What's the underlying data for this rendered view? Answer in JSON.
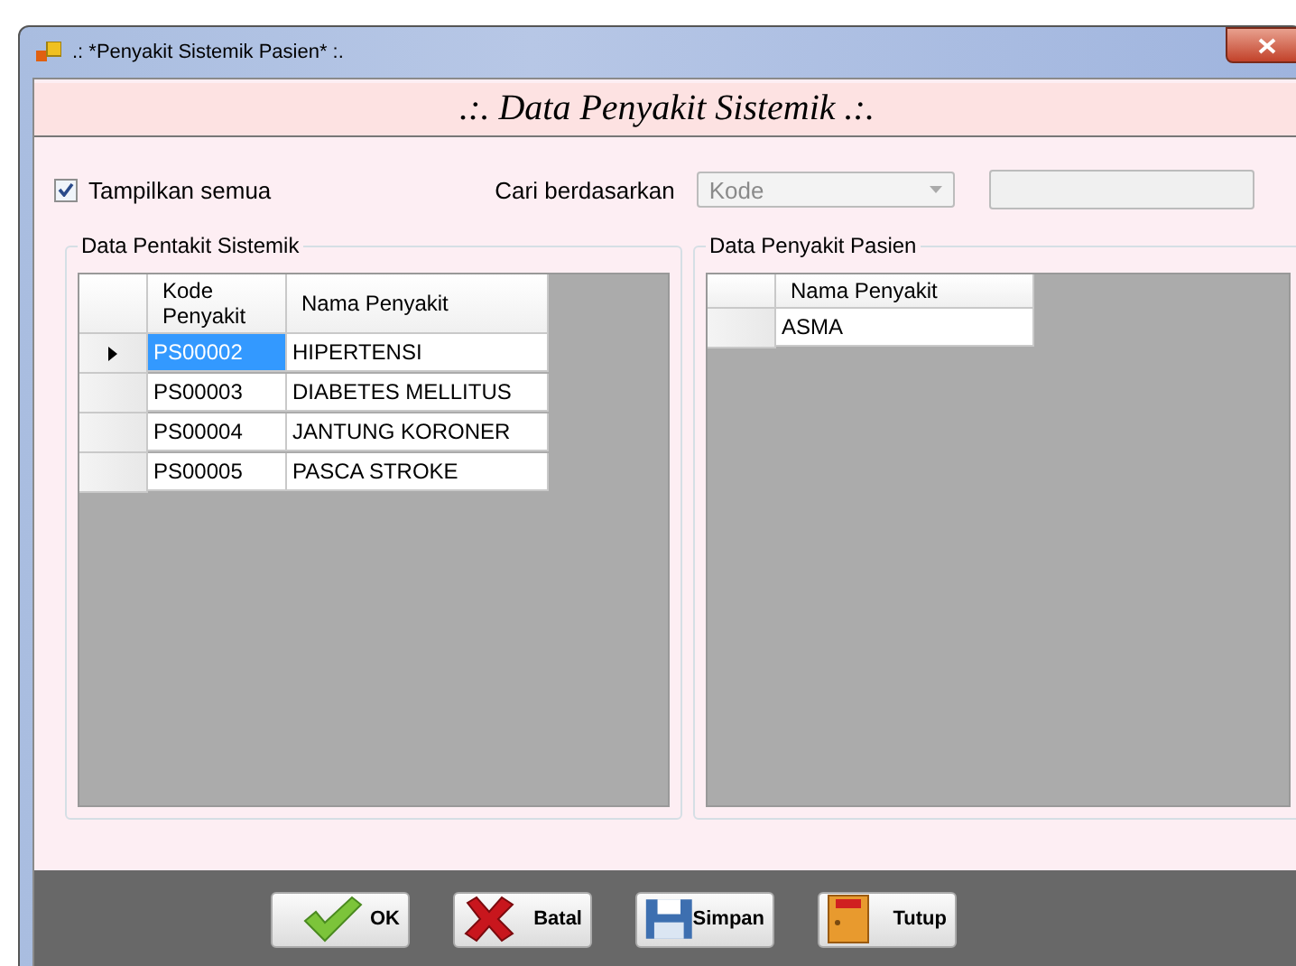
{
  "window": {
    "title": ".: *Penyakit Sistemik Pasien* :."
  },
  "header": ".:. Data Penyakit Sistemik .:.",
  "filter": {
    "show_all": {
      "label": "Tampilkan semua",
      "checked": true
    },
    "search_label": "Cari berdasarkan",
    "search_by": {
      "value": "Kode",
      "disabled": true
    },
    "search_text": {
      "disabled": true
    }
  },
  "panels": [
    {
      "title": "Data Pentakit Sistemik",
      "columns": [
        "Kode Penyakit",
        "Nama Penyakit"
      ],
      "rows": [
        {
          "cells": [
            "PS00002",
            "HIPERTENSI"
          ],
          "selected": true
        },
        {
          "cells": [
            "PS00003",
            "DIABETES MELLITUS"
          ],
          "selected": false
        },
        {
          "cells": [
            "PS00004",
            "JANTUNG KORONER"
          ],
          "selected": false
        },
        {
          "cells": [
            "PS00005",
            "PASCA STROKE"
          ],
          "selected": false
        }
      ]
    },
    {
      "title": "Data Penyakit Pasien",
      "columns": [
        "Nama Penyakit"
      ],
      "rows": [
        {
          "cells": [
            "ASMA"
          ],
          "selected": false
        }
      ]
    }
  ],
  "buttons": [
    {
      "label": "OK",
      "kind": "ok"
    },
    {
      "label": "Batal",
      "kind": "cancel"
    },
    {
      "label": "Simpan",
      "kind": "save"
    },
    {
      "label": "Tutup",
      "kind": "exit"
    }
  ]
}
